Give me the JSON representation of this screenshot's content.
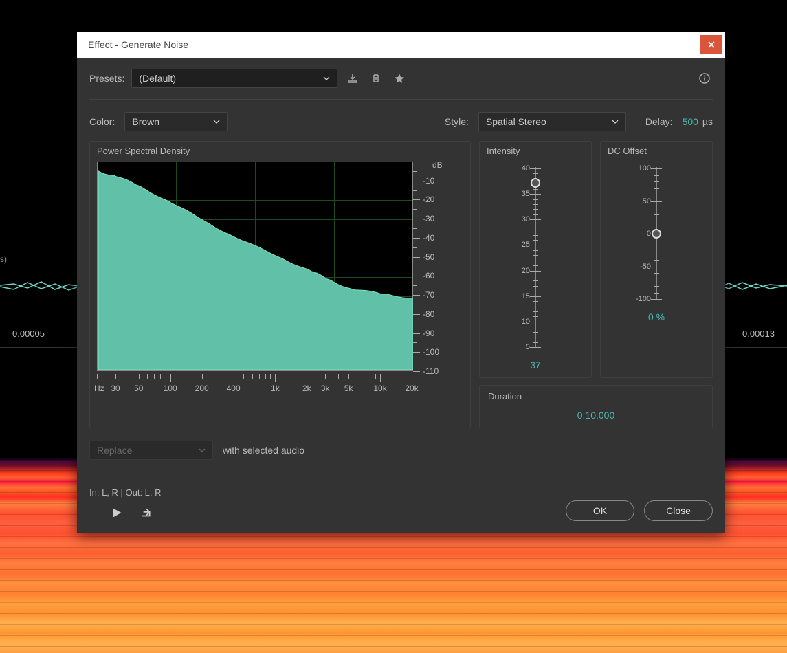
{
  "titlebar": {
    "title": "Effect - Generate Noise"
  },
  "background": {
    "wave_label": "s)",
    "time_left": "0.00005",
    "time_right": "0.00013"
  },
  "presets": {
    "label": "Presets:",
    "selected": "(Default)"
  },
  "controls": {
    "color_label": "Color:",
    "color_value": "Brown",
    "style_label": "Style:",
    "style_value": "Spatial Stereo",
    "delay_label": "Delay:",
    "delay_value": "500",
    "delay_unit": "µs"
  },
  "psd": {
    "title": "Power Spectral Density",
    "db_unit": "dB",
    "db_ticks": [
      "-10",
      "-20",
      "-30",
      "-40",
      "-50",
      "-60",
      "-70",
      "-80",
      "-90",
      "-100",
      "-110"
    ],
    "hz_unit": "Hz",
    "hz_labels": [
      "30",
      "50",
      "100",
      "200",
      "400",
      "1k",
      "2k",
      "3k",
      "5k",
      "10k",
      "20k"
    ]
  },
  "intensity": {
    "title": "Intensity",
    "ticks": [
      "40",
      "35",
      "30",
      "25",
      "20",
      "15",
      "10",
      "5"
    ],
    "value": "37",
    "min": 2,
    "max": 40
  },
  "dc_offset": {
    "title": "DC Offset",
    "ticks": [
      "100",
      "50",
      "0",
      "-50",
      "-100"
    ],
    "value_display": "0 %",
    "value": 0,
    "min": -100,
    "max": 100
  },
  "duration": {
    "title": "Duration",
    "value": "0:10.000"
  },
  "replace": {
    "selected": "Replace",
    "suffix": "with selected audio"
  },
  "footer": {
    "io": "In: L, R | Out: L, R",
    "ok": "OK",
    "close": "Close"
  },
  "chart_data": {
    "type": "area",
    "title": "Power Spectral Density",
    "xlabel": "Hz",
    "ylabel": "dB",
    "x_scale": "log",
    "x_range": [
      20,
      20000
    ],
    "ylim": [
      -110,
      0
    ],
    "x": [
      20,
      30,
      50,
      100,
      200,
      400,
      1000,
      2000,
      3000,
      5000,
      10000,
      20000
    ],
    "y": [
      -5,
      -8,
      -13,
      -22,
      -31,
      -40,
      -50,
      -57,
      -62,
      -67,
      -70,
      -72
    ]
  }
}
